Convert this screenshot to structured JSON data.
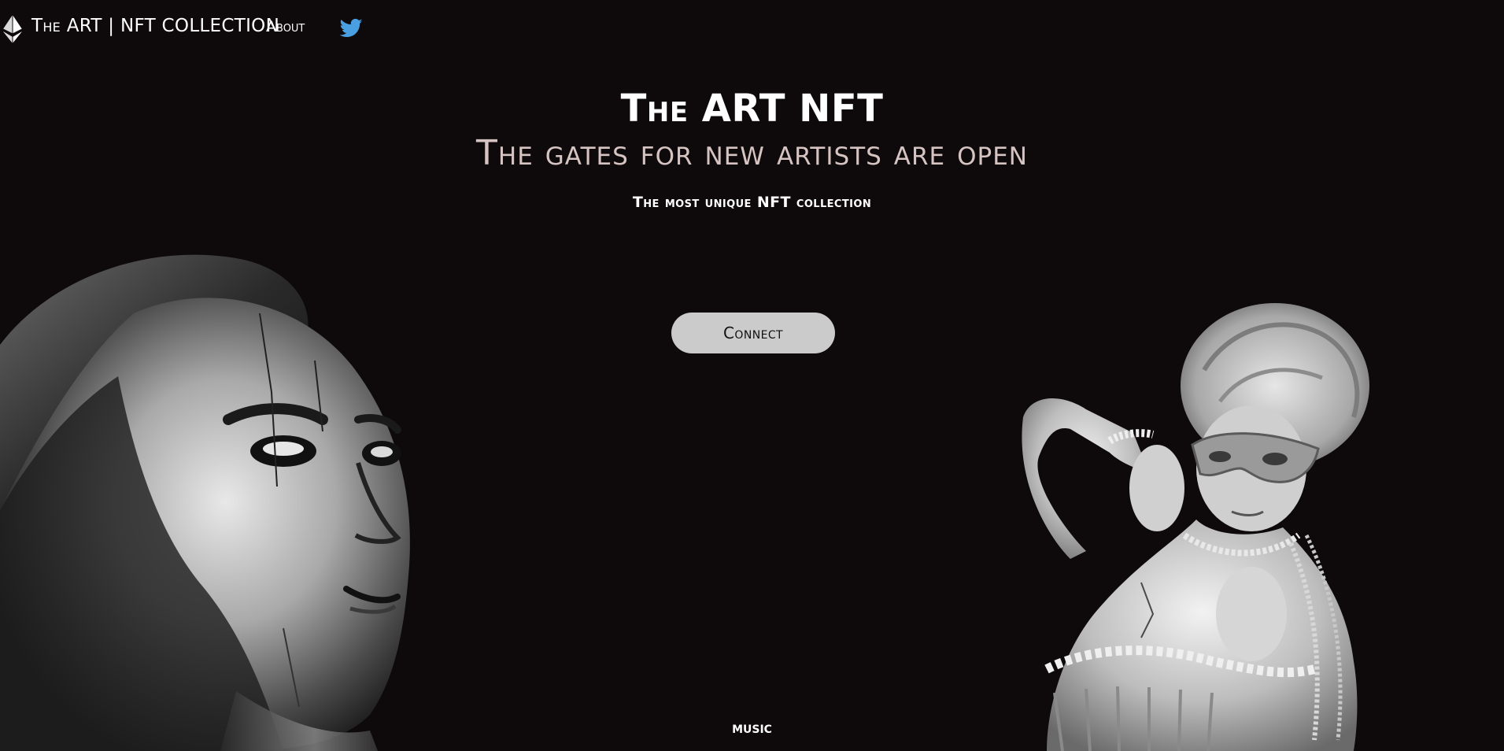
{
  "nav": {
    "logo_icon": "ethereum-icon",
    "brand": "The ART | NFT COLLECTION",
    "about": "About",
    "social_icon": "twitter-icon"
  },
  "hero": {
    "title": "The ART NFT",
    "subtitle": "The gates for new artists are open",
    "tagline": "The most unique NFT collection",
    "connect_label": "Connect"
  },
  "footer": {
    "music_label": "MUSIC"
  },
  "colors": {
    "background": "#0e090a",
    "subtitle": "#d5c4c2",
    "button": "#cbcbcb",
    "twitter": "#4a9fe0"
  }
}
